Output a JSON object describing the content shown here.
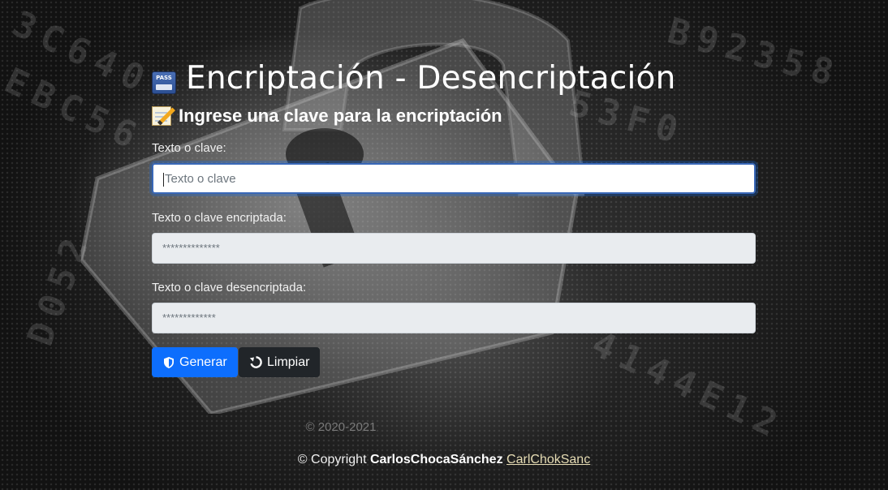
{
  "header": {
    "title": "Encriptación - Desencriptación",
    "pass_icon_text": "PASS"
  },
  "subheader": {
    "title": "Ingrese una clave para la encriptación"
  },
  "form": {
    "input_label": "Texto o clave:",
    "input_value": "",
    "input_placeholder": "Texto o clave",
    "encrypted_label": "Texto o clave encriptada:",
    "encrypted_value": "**************",
    "decrypted_label": "Texto o clave desencriptada:",
    "decrypted_value": "*************"
  },
  "buttons": {
    "generate_label": "Generar",
    "clear_label": "Limpiar"
  },
  "footer": {
    "years": "© 2020-2021",
    "copyright_prefix": "© Copyright",
    "author": "CarlosChocaSánchez",
    "handle": "CarlChokSanc"
  },
  "colors": {
    "primary": "#0d6efd",
    "dark": "#212529",
    "readonly_bg": "#e9ecef",
    "link": "#e6dcb4"
  }
}
